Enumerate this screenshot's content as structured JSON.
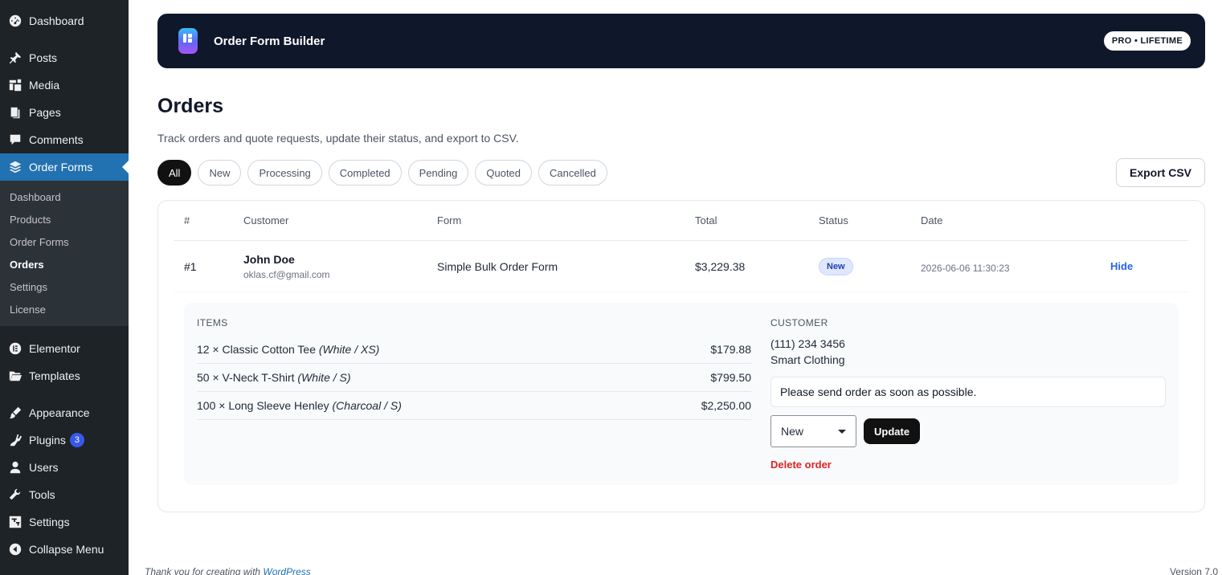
{
  "sidebar": {
    "top_items": [
      {
        "label": "Dashboard",
        "icon": "dashboard-icon"
      },
      {
        "label": "Posts",
        "icon": "pin-icon"
      },
      {
        "label": "Media",
        "icon": "media-icon"
      },
      {
        "label": "Pages",
        "icon": "pages-icon"
      },
      {
        "label": "Comments",
        "icon": "comments-icon"
      },
      {
        "label": "Order Forms",
        "icon": "layers-icon"
      }
    ],
    "submenu": [
      "Dashboard",
      "Products",
      "Order Forms",
      "Orders",
      "Settings",
      "License"
    ],
    "bottom_items": [
      {
        "label": "Elementor",
        "icon": "elementor-icon"
      },
      {
        "label": "Templates",
        "icon": "folder-icon"
      },
      {
        "label": "Appearance",
        "icon": "brush-icon"
      },
      {
        "label": "Plugins",
        "icon": "plugin-icon",
        "badge": "3"
      },
      {
        "label": "Users",
        "icon": "user-icon"
      },
      {
        "label": "Tools",
        "icon": "wrench-icon"
      },
      {
        "label": "Settings",
        "icon": "settings-icon"
      },
      {
        "label": "Collapse Menu",
        "icon": "collapse-icon"
      }
    ]
  },
  "banner": {
    "title": "Order Form Builder",
    "plan": "PRO • LIFETIME"
  },
  "page": {
    "title": "Orders",
    "subtitle": "Track orders and quote requests, update their status, and export to CSV."
  },
  "filters": [
    "All",
    "New",
    "Processing",
    "Completed",
    "Pending",
    "Quoted",
    "Cancelled"
  ],
  "export_label": "Export CSV",
  "table": {
    "headers": [
      "#",
      "Customer",
      "Form",
      "Total",
      "Status",
      "Date"
    ],
    "rows": [
      {
        "num": "#1",
        "customer_name": "John Doe",
        "customer_email": "oklas.cf@gmail.com",
        "form": "Simple Bulk Order Form",
        "total": "$3,229.38",
        "status": "New",
        "date": "2026-06-06 11:30:23",
        "action": "Hide"
      }
    ]
  },
  "details": {
    "items_label": "ITEMS",
    "items": [
      {
        "text": "12 × Classic Cotton Tee",
        "variant": "(White / XS)",
        "price": "$179.88"
      },
      {
        "text": "50 × V-Neck T-Shirt",
        "variant": "(White / S)",
        "price": "$799.50"
      },
      {
        "text": "100 × Long Sleeve Henley",
        "variant": "(Charcoal / S)",
        "price": "$2,250.00"
      }
    ],
    "customer_label": "CUSTOMER",
    "phone": "(111) 234 3456",
    "company": "Smart Clothing",
    "note": "Please send order as soon as possible.",
    "status_value": "New",
    "update_label": "Update",
    "delete_label": "Delete order"
  },
  "footer": {
    "thanks": "Thank you for creating with",
    "link": "WordPress",
    "version": "Version 7.0"
  },
  "colors": {
    "sidebar": "#1d2327",
    "active": "#2271b1",
    "banner": "#0f172a",
    "accent_link": "#2563eb",
    "danger": "#dc2626"
  }
}
